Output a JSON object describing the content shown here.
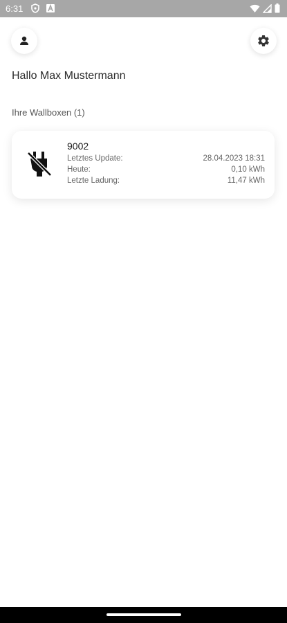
{
  "status_bar": {
    "time": "6:31",
    "icons": [
      "shield-icon",
      "a-box-icon",
      "wifi-icon",
      "signal-icon",
      "battery-icon"
    ]
  },
  "header": {
    "left_button_icon": "person-icon",
    "right_button_icon": "gear-icon"
  },
  "greeting": "Hallo Max Mustermann",
  "section_title": "Ihre Wallboxen (1)",
  "wallboxes": [
    {
      "icon": "plug-off-icon",
      "name": "9002",
      "rows": [
        {
          "label": "Letztes Update:",
          "value": "28.04.2023 18:31"
        },
        {
          "label": "Heute:",
          "value": "0,10 kWh"
        },
        {
          "label": "Letzte Ladung:",
          "value": "11,47 kWh"
        }
      ]
    }
  ],
  "colors": {
    "status_bar_bg": "#a7a7a7",
    "background": "#ffffff",
    "nav_bar_bg": "#000000"
  }
}
